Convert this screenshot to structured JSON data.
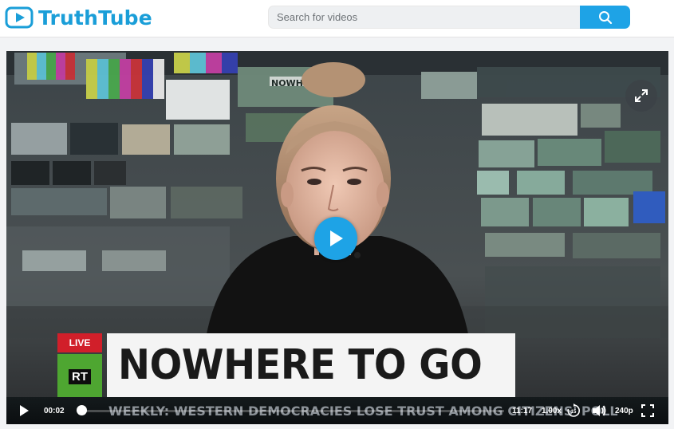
{
  "app": {
    "name": "TruthTube",
    "brand_color": "#1a9ed8"
  },
  "search": {
    "placeholder": "Search for videos",
    "value": "",
    "button_icon": "search-icon",
    "button_color": "#1ea3e6"
  },
  "video": {
    "live_badge": "LIVE",
    "channel_logo": "RT",
    "headline": "NOWHERE TO GO",
    "ticker": "WEEKLY: WESTERN DEMOCRACIES LOSE TRUST AMONG CITIZENS' POLL",
    "wall_sign": "NOWHERE T",
    "big_play_icon": "play-icon",
    "corner_icon": "expand-icon"
  },
  "controls": {
    "current_time": "00:02",
    "total_time": "11:17",
    "progress_fraction": 0.003,
    "speed": "1.00x",
    "skip_label": "15",
    "quality": "240p",
    "icons": [
      "play-icon",
      "skip-forward-icon",
      "volume-icon",
      "fullscreen-icon"
    ]
  }
}
